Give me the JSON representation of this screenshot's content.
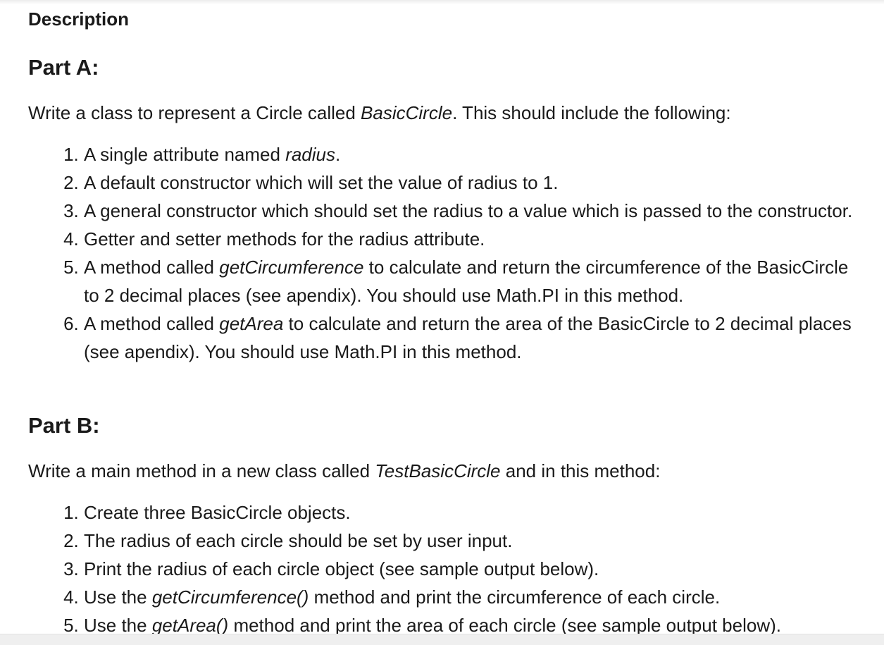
{
  "description_title": "Description",
  "part_a": {
    "heading": "Part A:",
    "intro": {
      "pre": "Write a class to represent a Circle called ",
      "em": "BasicCircle",
      "post": ". This should include the following:"
    },
    "items": [
      {
        "pre": "A single attribute named ",
        "em": "radius",
        "post": "."
      },
      {
        "pre": "A default constructor which will set the value of radius to 1.",
        "em": "",
        "post": ""
      },
      {
        "pre": "A general constructor which should set the radius to a value which is passed to the constructor.",
        "em": "",
        "post": ""
      },
      {
        "pre": "Getter and setter methods for the radius attribute.",
        "em": "",
        "post": ""
      },
      {
        "pre": "A method called ",
        "em": "getCircumference",
        "post": " to calculate and return the circumference of the BasicCircle to 2 decimal places (see apendix). You should use Math.PI in this method."
      },
      {
        "pre": "A method called ",
        "em": "getArea",
        "post": " to calculate and return the area of the BasicCircle to 2 decimal places (see apendix). You should use Math.PI in this method."
      }
    ]
  },
  "part_b": {
    "heading": "Part B:",
    "intro": {
      "pre": "Write a main method in a new class called ",
      "em": "TestBasicCircle",
      "post": " and in this method:"
    },
    "items": [
      {
        "pre": "Create three BasicCircle objects.",
        "em": "",
        "post": ""
      },
      {
        "pre": "The radius of each circle should be set by user input.",
        "em": "",
        "post": ""
      },
      {
        "pre": "Print the radius of each circle object (see sample output below).",
        "em": "",
        "post": ""
      },
      {
        "pre": "Use the ",
        "em": "getCircumference()",
        "post": " method and print the circumference of each circle."
      },
      {
        "pre": "Use the ",
        "em": "getArea()",
        "post": " method and print the area of each circle (see sample output below)."
      }
    ]
  }
}
